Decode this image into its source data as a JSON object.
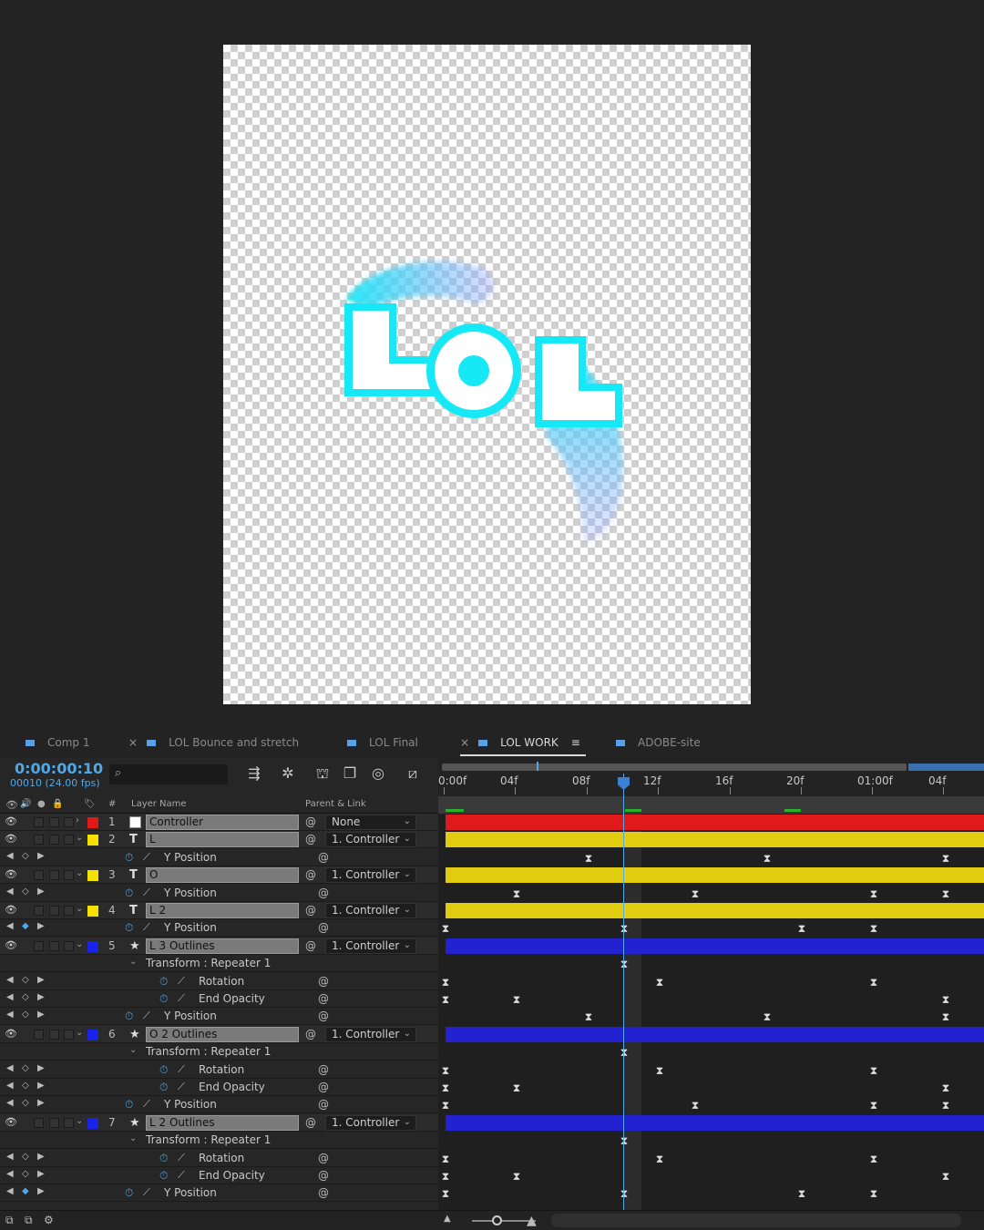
{
  "tabs": [
    {
      "label": "Comp 1",
      "close": ""
    },
    {
      "label": "LOL Bounce and stretch",
      "close": "×"
    },
    {
      "label": "LOL Final",
      "close": ""
    },
    {
      "label": "LOL WORK",
      "close": "×",
      "active": true
    },
    {
      "label": "ADOBE-site",
      "close": ""
    }
  ],
  "timecode": "0:00:00:10",
  "timecode_sub": "00010 (24.00 fps)",
  "search_icon": "search-icon",
  "columns": {
    "number": "#",
    "layer_name": "Layer Name",
    "parent": "Parent & Link"
  },
  "ruler_ticks": [
    "0:00f",
    "04f",
    "08f",
    "12f",
    "16f",
    "20f",
    "01:00f",
    "04f"
  ],
  "artwork": {
    "text": "LOL",
    "fill": "#ffffff",
    "outline": "#16e8f5",
    "trail": "#1fd8f0"
  },
  "layers": [
    {
      "num": "1",
      "type": "",
      "name": "Controller",
      "parent": "None",
      "label": "#e21818",
      "bar": "#e01a1a",
      "twirl": "›"
    },
    {
      "num": "2",
      "type": "T",
      "name": "L",
      "parent": "1. Controller",
      "label": "#f5e100",
      "bar": "#e2cc10",
      "twirl": "⌄"
    },
    {
      "num": "3",
      "type": "T",
      "name": "O",
      "parent": "1. Controller",
      "label": "#f5e100",
      "bar": "#e2cc10",
      "twirl": "⌄"
    },
    {
      "num": "4",
      "type": "T",
      "name": "L 2",
      "parent": "1. Controller",
      "label": "#f5e100",
      "bar": "#e2cc10",
      "twirl": "⌄"
    },
    {
      "num": "5",
      "type": "★",
      "name": "L 3 Outlines",
      "parent": "1. Controller",
      "label": "#1a24e8",
      "bar": "#2222d0",
      "twirl": "⌄"
    },
    {
      "num": "6",
      "type": "★",
      "name": "O 2 Outlines",
      "parent": "1. Controller",
      "label": "#1a24e8",
      "bar": "#2222d0",
      "twirl": "⌄"
    },
    {
      "num": "7",
      "type": "★",
      "name": "L 2 Outlines",
      "parent": "1. Controller",
      "label": "#1a24e8",
      "bar": "#2222d0",
      "twirl": "⌄"
    }
  ],
  "props": {
    "y_position": "Y Position",
    "repeater": "Transform : Repeater 1",
    "rotation": "Rotation",
    "end_opacity": "End Opacity"
  },
  "footer_icons": [
    "comp-icon",
    "render-icon",
    "flowchart-icon"
  ]
}
